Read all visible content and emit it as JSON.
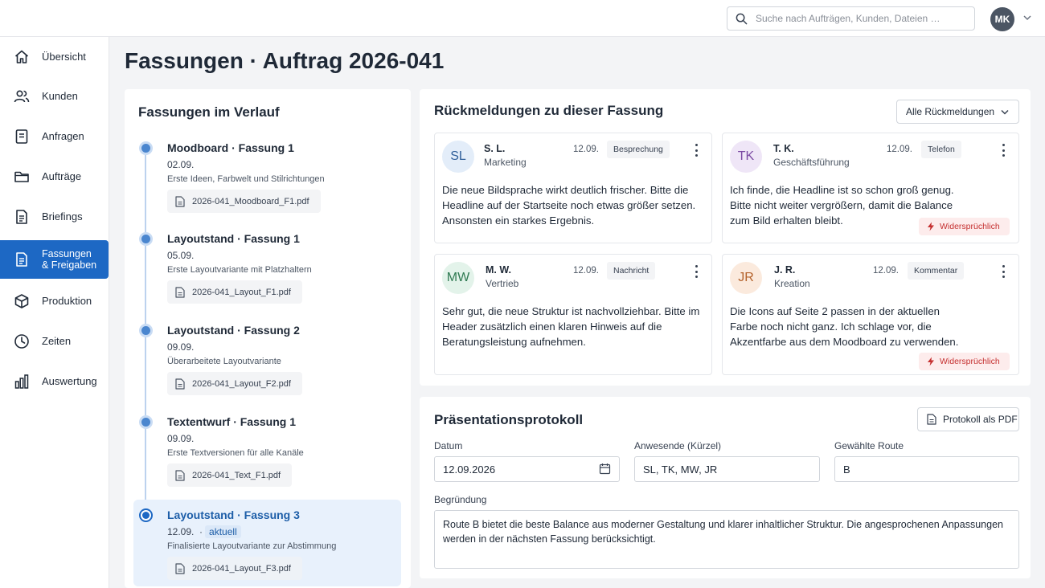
{
  "search": {
    "placeholder": "Suche nach Aufträgen, Kunden, Dateien …"
  },
  "user": {
    "initials": "MK"
  },
  "sidebar": {
    "items": [
      {
        "label": "Übersicht",
        "icon": "home-icon"
      },
      {
        "label": "Kunden",
        "icon": "users-icon"
      },
      {
        "label": "Anfragen",
        "icon": "document-icon"
      },
      {
        "label": "Aufträge",
        "icon": "folder-icon"
      },
      {
        "label": "Briefings",
        "icon": "document-lines-icon"
      },
      {
        "label_line1": "Fassungen",
        "label_line2": "& Freigaben",
        "icon": "document-check-icon",
        "active": true
      },
      {
        "label": "Produktion",
        "icon": "cube-icon"
      },
      {
        "label": "Zeiten",
        "icon": "clock-icon"
      },
      {
        "label": "Auswertung",
        "icon": "bar-chart-icon"
      }
    ]
  },
  "page": {
    "title": "Fassungen · Auftrag 2026-041"
  },
  "history": {
    "title": "Fassungen im Verlauf",
    "items": [
      {
        "title": "Moodboard · Fassung 1",
        "date": "02.09.",
        "desc": "Erste Ideen, Farbwelt und Stilrichtungen",
        "file": "2026-041_Moodboard_F1.pdf"
      },
      {
        "title": "Layoutstand · Fassung 1",
        "date": "05.09.",
        "desc": "Erste Layoutvariante mit Platzhaltern",
        "file": "2026-041_Layout_F1.pdf"
      },
      {
        "title": "Layoutstand · Fassung 2",
        "date": "09.09.",
        "desc": "Überarbeitete Layoutvariante",
        "file": "2026-041_Layout_F2.pdf"
      },
      {
        "title": "Textentwurf · Fassung 1",
        "date": "09.09.",
        "desc": "Erste Textversionen für alle Kanäle",
        "file": "2026-041_Text_F1.pdf"
      },
      {
        "title": "Layoutstand · Fassung 3",
        "date": "12.09.",
        "sep": "·",
        "badge": "aktuell",
        "desc": "Finalisierte Layoutvariante zur Abstimmung",
        "file": "2026-041_Layout_F3.pdf",
        "current": true
      }
    ]
  },
  "feedback": {
    "title": "Rückmeldungen zu dieser Fassung",
    "filter_label": "Alle Rückmeldungen",
    "cards": [
      {
        "initials": "SL",
        "name": "S. L.",
        "role": "Marketing",
        "date": "12.09.",
        "tag": "Besprechung",
        "text": "Die neue Bildsprache wirkt deutlich frischer. Bitte die Headline auf der Startseite noch etwas größer setzen. Ansonsten ein starkes Ergebnis.",
        "avatar_bg": "#e3edf9",
        "avatar_fg": "#2f5f9a"
      },
      {
        "initials": "TK",
        "name": "T. K.",
        "role": "Geschäftsführung",
        "date": "12.09.",
        "tag": "Telefon",
        "text": "Ich finde, die Headline ist so schon groß genug. Bitte nicht weiter vergrößern, damit die Balance zum Bild erhalten bleibt.",
        "warning": "Widersprüchlich",
        "avatar_bg": "#efe6f7",
        "avatar_fg": "#7b4aa3"
      },
      {
        "initials": "MW",
        "name": "M. W.",
        "role": "Vertrieb",
        "date": "12.09.",
        "tag": "Nachricht",
        "text": "Sehr gut, die neue Struktur ist nachvollziehbar. Bitte im Header zusätzlich einen klaren Hinweis auf die Beratungsleistung aufnehmen.",
        "avatar_bg": "#e3f3ea",
        "avatar_fg": "#2f7a52"
      },
      {
        "initials": "JR",
        "name": "J. R.",
        "role": "Kreation",
        "date": "12.09.",
        "tag": "Kommentar",
        "text": "Die Icons auf Seite 2 passen in der aktuellen Farbe noch nicht ganz. Ich schlage vor, die Akzentfarbe aus dem Moodboard zu verwenden.",
        "warning": "Widersprüchlich",
        "avatar_bg": "#fbeadd",
        "avatar_fg": "#b4622b"
      }
    ]
  },
  "protocol": {
    "title": "Präsentationsprotokoll",
    "pdf_button": "Protokoll als PDF",
    "date_label": "Datum",
    "date_value": "12.09.2026",
    "attendees_label": "Anwesende (Kürzel)",
    "attendees_value": "SL, TK, MW, JR",
    "route_label": "Gewählte Route",
    "route_value": "B",
    "reason_label": "Begründung",
    "reason_value": "Route B bietet die beste Balance aus moderner Gestaltung und klarer inhaltlicher Struktur. Die angesprochenen Anpassungen werden in der nächsten Fassung berücksichtigt."
  },
  "colors": {
    "accent": "#1d68c4",
    "warning": "#c53030",
    "warning_bg": "#fdecec"
  }
}
